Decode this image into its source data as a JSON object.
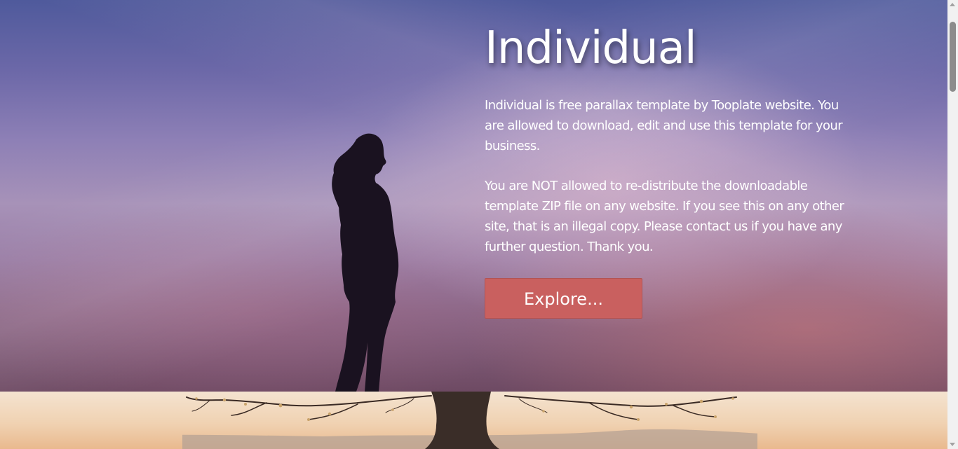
{
  "hero": {
    "title": "Individual",
    "paragraph1": "Individual is free parallax template by Tooplate website. You are allowed to download, edit and use this template for your business.",
    "paragraph2": "You are NOT allowed to re-distribute the downloadable template ZIP file on any website. If you see this on any other site, that is an illegal copy. Please contact us if you have any further question. Thank you.",
    "explore_label": "Explore...",
    "button_color": "#c9605f",
    "background_image": "woman-silhouette-at-sunset-photo"
  },
  "section_two": {
    "background_image": "tree-silhouette-at-sunset-photo"
  },
  "scrollbar": {
    "up_icon": "scroll-up-arrow-icon",
    "down_icon": "scroll-down-arrow-icon"
  }
}
